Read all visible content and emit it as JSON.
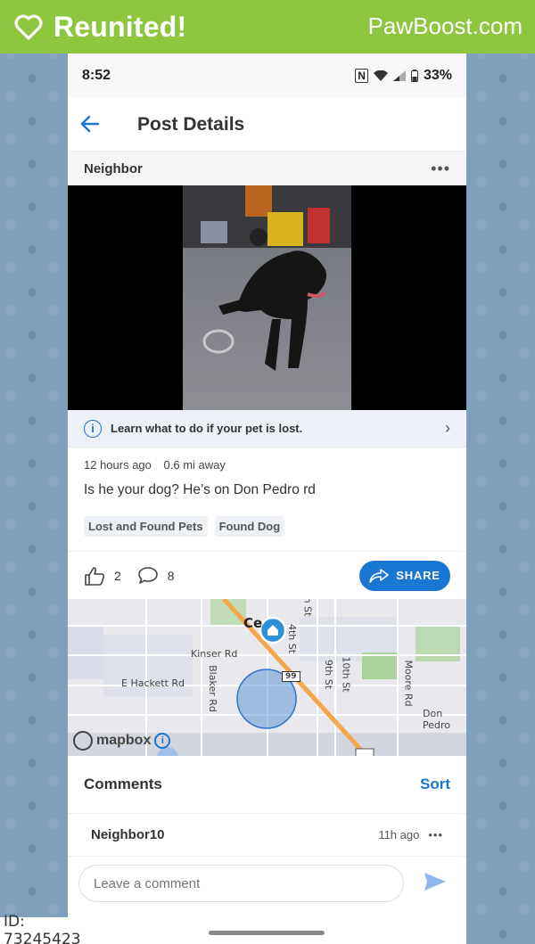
{
  "banner": {
    "title": "Reunited!",
    "brand": "PawBoost.com"
  },
  "status_bar": {
    "time": "8:52",
    "battery": "33%"
  },
  "app_bar": {
    "title": "Post Details"
  },
  "post": {
    "author": "Neighbor",
    "learn_text": "Learn what to do if your pet is lost.",
    "time_ago": "12 hours ago",
    "distance": "0.6 mi away",
    "text": "Is he your dog? He’s on Don Pedro rd",
    "tags": [
      "Lost and Found Pets",
      "Found Dog"
    ],
    "likes": "2",
    "comments_count": "8",
    "share_label": "SHARE"
  },
  "map": {
    "labels": {
      "ce": "Ce",
      "kinser": "Kinser Rd",
      "hackett": "E Hackett Rd",
      "blaker": "Blaker Rd",
      "fourth": "4th St",
      "ninth": "9th St",
      "tenth": "10th St",
      "moore": "Moore Rd",
      "donpedro": "Don Pedro",
      "route": "99",
      "sth": "h St"
    },
    "attribution": "mapbox"
  },
  "comments": {
    "title": "Comments",
    "sort_label": "Sort",
    "items": [
      {
        "user": "Neighbor10",
        "time": "11h ago"
      }
    ]
  },
  "composer": {
    "placeholder": "Leave a comment"
  },
  "id_label": "ID: 73245423",
  "colors": {
    "banner": "#8dc63f",
    "accent": "#1976d2"
  }
}
